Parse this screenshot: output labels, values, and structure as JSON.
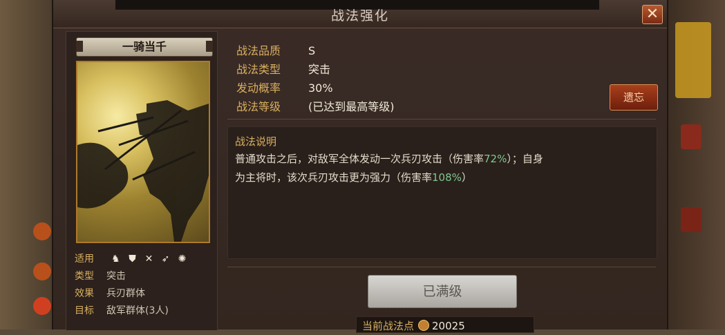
{
  "dialog": {
    "title": "战法强化",
    "close_icon": "close-icon"
  },
  "skill": {
    "name": "一骑当千",
    "quality_label": "战法品质",
    "quality": "S",
    "type_label": "战法类型",
    "type": "突击",
    "rate_label": "发动概率",
    "rate": "30%",
    "level_label": "战法等级",
    "level": "(已达到最高等级)"
  },
  "forget_button": "遗忘",
  "description": {
    "title": "战法说明",
    "line1_a": "普通攻击之后，对敌军全体发动一次兵刃攻击（伤害率",
    "line1_pct": "72%",
    "line1_b": "）；自身",
    "line2_a": "为主将时，该次兵刃攻击更为强力（伤害率",
    "line2_pct": "108%",
    "line2_b": "）"
  },
  "meta": {
    "applicable_label": "适用",
    "applicable_icons": [
      "cavalry-icon",
      "shield-icon",
      "bow-icon",
      "spear-icon",
      "siege-icon"
    ],
    "type_label": "类型",
    "type": "突击",
    "effect_label": "效果",
    "effect": "兵刃群体",
    "target_label": "目标",
    "target": "敌军群体(3人)"
  },
  "max_button": "已满级",
  "points": {
    "label": "当前战法点",
    "value": "20025"
  },
  "colors": {
    "accent_gold": "#d9b060",
    "percent_green": "#7ec890",
    "forget_red": "#a8401c"
  }
}
